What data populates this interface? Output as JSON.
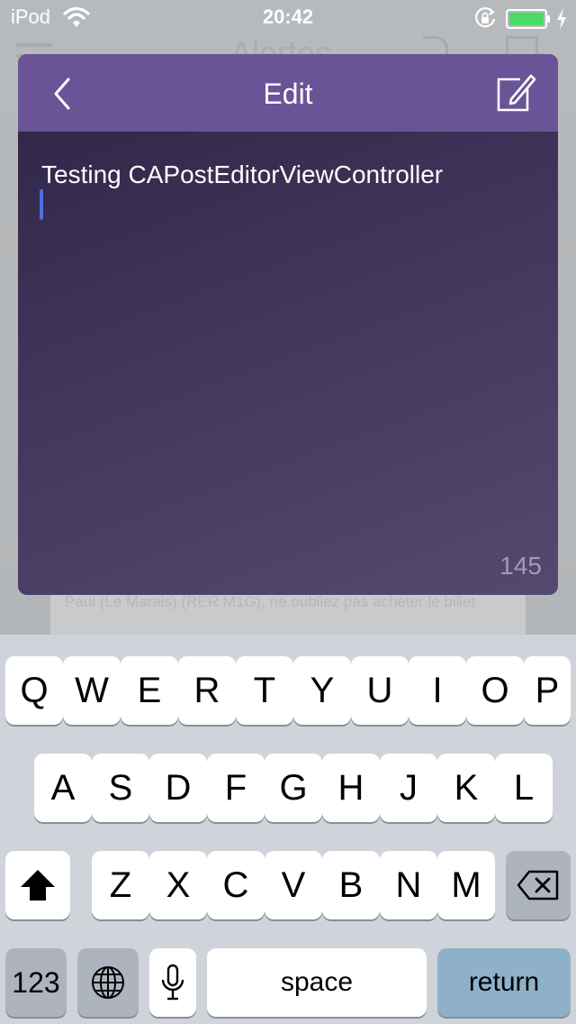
{
  "status_bar": {
    "carrier": "iPod",
    "time": "20:42",
    "battery_color": "#4cd964"
  },
  "background": {
    "title": "Alertes",
    "notice_text": "Paul (Le Marais) (RER M1G), ne oubliez pas acheter le billet"
  },
  "modal": {
    "title": "Edit",
    "editor_text": "Testing CAPostEditorViewController",
    "char_count": "145",
    "header_color": "#6a5497",
    "cursor_color": "#4f6ee0"
  },
  "keyboard": {
    "row1": [
      "Q",
      "W",
      "E",
      "R",
      "T",
      "Y",
      "U",
      "I",
      "O",
      "P"
    ],
    "row2": [
      "A",
      "S",
      "D",
      "F",
      "G",
      "H",
      "J",
      "K",
      "L"
    ],
    "row3": [
      "Z",
      "X",
      "C",
      "V",
      "B",
      "N",
      "M"
    ],
    "numbers_label": "123",
    "space_label": "space",
    "return_label": "return",
    "return_color": "#8fb0c9"
  }
}
